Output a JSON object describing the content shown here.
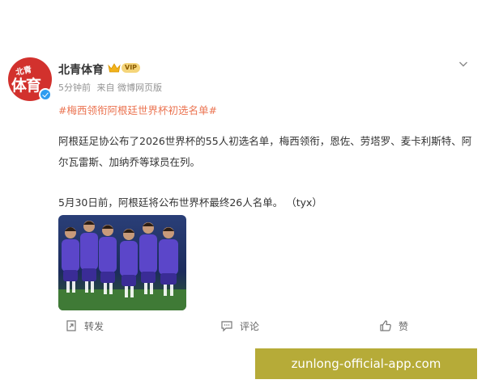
{
  "post": {
    "author": {
      "name": "北青体育",
      "avatar_small_text": "北青",
      "avatar_big_text": "体育",
      "badge_text": "VIP"
    },
    "time": "5分钟前",
    "source": "来自 微博网页版",
    "topic": "#梅西领衔阿根廷世界杯初选名单#",
    "paragraph1": "阿根廷足协公布了2026世界杯的55人初选名单，梅西领衔，恩佐、劳塔罗、麦卡利斯特、阿尔瓦雷斯、加纳乔等球员在列。",
    "paragraph2": "5月30日前，阿根廷将公布世界杯最终26人名单。 （tyx）"
  },
  "actions": {
    "repost": "转发",
    "comment": "评论",
    "like": "赞"
  },
  "watermark": "zunlong-official-app.com",
  "colors": {
    "topic": "#eb7350",
    "avatar": "#d2312d",
    "verified": "#2d9cf0",
    "banner": "#b6ab38",
    "photo_background": "#1f2f60",
    "jersey": "#5b46c9"
  }
}
